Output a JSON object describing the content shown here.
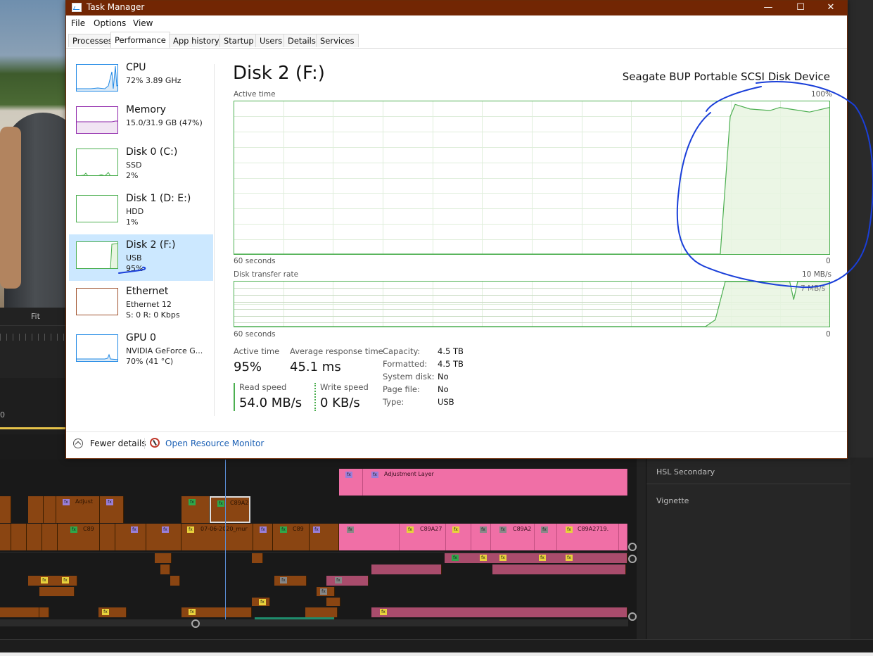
{
  "window": {
    "title": "Task Manager",
    "controls": {
      "minimize": "—",
      "maximize": "☐",
      "close": "✕"
    }
  },
  "menu": [
    "File",
    "Options",
    "View"
  ],
  "tabs": [
    "Processes",
    "Performance",
    "App history",
    "Startup",
    "Users",
    "Details",
    "Services"
  ],
  "active_tab": "Performance",
  "sidebar": [
    {
      "name": "CPU",
      "sub1": "72%  3.89 GHz",
      "sub2": "",
      "color": "#1e88e5",
      "fill": "#dbeaf7"
    },
    {
      "name": "Memory",
      "sub1": "15.0/31.9 GB (47%)",
      "sub2": "",
      "color": "#8e24aa",
      "fill": "#f1e4f3"
    },
    {
      "name": "Disk 0 (C:)",
      "sub1": "SSD",
      "sub2": "2%",
      "color": "#4caf50",
      "fill": "#e8f5e1"
    },
    {
      "name": "Disk 1 (D: E:)",
      "sub1": "HDD",
      "sub2": "1%",
      "color": "#4caf50",
      "fill": "#e8f5e1"
    },
    {
      "name": "Disk 2 (F:)",
      "sub1": "USB",
      "sub2": "95%",
      "color": "#4caf50",
      "fill": "#e8f5e1",
      "selected": true
    },
    {
      "name": "Ethernet",
      "sub1": "Ethernet 12",
      "sub2": "S: 0  R: 0 Kbps",
      "color": "#a0522d",
      "fill": "#fbf1ea"
    },
    {
      "name": "GPU 0",
      "sub1": "NVIDIA GeForce G...",
      "sub2": "70%  (41 °C)",
      "color": "#1e88e5",
      "fill": "#dbeaf7"
    }
  ],
  "main": {
    "title": "Disk 2 (F:)",
    "device": "Seagate BUP Portable SCSI Disk Device",
    "active_chart": {
      "label": "Active time",
      "max_label": "100%",
      "time_label": "60 seconds",
      "zero_label": "0",
      "color": "#4caf50"
    },
    "transfer_chart": {
      "label": "Disk transfer rate",
      "max_label": "10 MB/s",
      "mid_label": "7 MB/s",
      "time_label": "60 seconds",
      "zero_label": "0",
      "color": "#4caf50"
    }
  },
  "chart_data": [
    {
      "type": "area",
      "title": "Active time",
      "x": [
        60,
        55,
        50,
        45,
        40,
        35,
        30,
        25,
        20,
        15,
        12,
        11,
        10,
        9.5,
        8,
        6,
        5,
        4,
        2,
        0
      ],
      "values": [
        0,
        0,
        0,
        0,
        0,
        0,
        0,
        0,
        0,
        0,
        0,
        0,
        90,
        98,
        95,
        94,
        96,
        95,
        93,
        96
      ],
      "ylim": [
        0,
        100
      ],
      "xlim": [
        60,
        0
      ],
      "xlabel": "60 seconds",
      "ymax_label": "100%"
    },
    {
      "type": "area",
      "title": "Disk transfer rate",
      "x": [
        60,
        55,
        50,
        45,
        40,
        35,
        30,
        25,
        20,
        15,
        12.5,
        11.5,
        10.5,
        8,
        4,
        3.6,
        3.2,
        2.8,
        2,
        0
      ],
      "values": [
        0,
        0,
        0,
        0,
        0,
        0,
        0,
        0,
        0,
        0,
        0,
        1.5,
        10,
        10,
        10,
        6,
        10,
        10,
        10,
        10
      ],
      "ylim": [
        0,
        10
      ],
      "xlim": [
        60,
        0
      ],
      "xlabel": "60 seconds",
      "ymax_label": "10 MB/s"
    }
  ],
  "stats": {
    "active_time": {
      "label": "Active time",
      "value": "95%"
    },
    "avg_response": {
      "label": "Average response time",
      "value": "45.1 ms"
    },
    "read_speed": {
      "label": "Read speed",
      "value": "54.0 MB/s"
    },
    "write_speed": {
      "label": "Write speed",
      "value": "0 KB/s"
    }
  },
  "properties": [
    {
      "label": "Capacity:",
      "value": "4.5 TB"
    },
    {
      "label": "Formatted:",
      "value": "4.5 TB"
    },
    {
      "label": "System disk:",
      "value": "No"
    },
    {
      "label": "Page file:",
      "value": "No"
    },
    {
      "label": "Type:",
      "value": "USB"
    }
  ],
  "footer": {
    "fewer_details": "Fewer details",
    "resource_monitor": "Open Resource Monitor"
  },
  "editor": {
    "fit_label": "Fit",
    "timeline_zero": "0",
    "right_panel": [
      "HSL Secondary",
      "Vignette"
    ],
    "clips": {
      "adjustment_layer": "Adjustment Layer",
      "adjust": "Adjust",
      "c89a_small": "C89A2",
      "c89": "C89",
      "date_clip": "07-06-2020_mur",
      "c89_2": "C89",
      "c89a27": "C89A27",
      "c89a2": "C89A2",
      "c89a2719": "C89A2719."
    },
    "fx": "fx"
  },
  "annotation": {
    "color": "#1a3fd9"
  }
}
